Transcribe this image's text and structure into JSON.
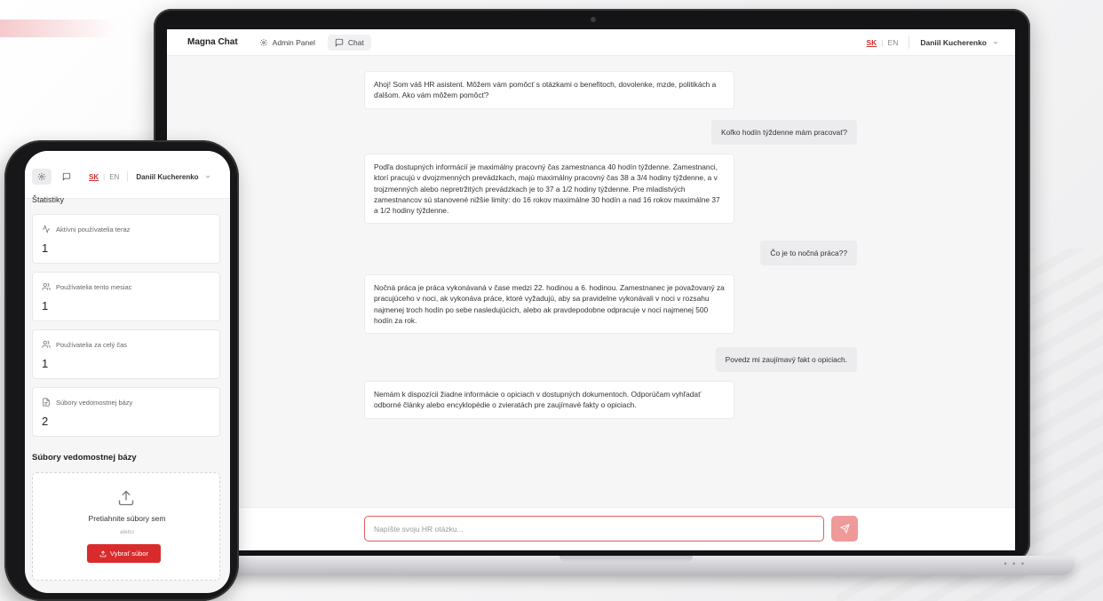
{
  "colors": {
    "accent": "#d92b2b",
    "input_border": "#e25c5c",
    "send_button": "#ef9a9a",
    "chat_bg": "#f6f6f7"
  },
  "laptop": {
    "header": {
      "brand": "Magna Chat",
      "nav": [
        {
          "label": "Admin Panel",
          "icon": "gear-icon"
        },
        {
          "label": "Chat",
          "icon": "message-square-icon",
          "active": true
        }
      ],
      "lang": {
        "sk": "SK",
        "en": "EN",
        "active": "SK"
      },
      "user": "Daniil Kucherenko"
    },
    "messages": [
      {
        "role": "bot",
        "text": "Ahoj! Som váš HR asistent. Môžem vám pomôcť s otázkami o benefitoch, dovolenke, mzde, politikách a ďalšom. Ako vám môžem pomôcť?"
      },
      {
        "role": "user",
        "text": "Koľko hodín týždenne mám pracovať?"
      },
      {
        "role": "bot",
        "text": "Podľa dostupných informácií je maximálny pracovný čas zamestnanca 40 hodín týždenne. Zamestnanci, ktorí pracujú v dvojzmenných prevádzkach, majú maximálny pracovný čas 38 a 3/4 hodiny týždenne, a v trojzmenných alebo nepretržitých prevádzkach je to 37 a 1/2 hodiny týždenne. Pre mladistvých zamestnancov sú stanovené nižšie limity: do 16 rokov maximálne 30 hodín a nad 16 rokov maximálne 37 a 1/2 hodiny týždenne."
      },
      {
        "role": "user",
        "text": "Čo je to nočná práca??"
      },
      {
        "role": "bot",
        "text": "Nočná práca je práca vykonávaná v čase medzi 22. hodinou a 6. hodinou. Zamestnanec je považovaný za pracujúceho v noci, ak vykonáva práce, ktoré vyžadujú, aby sa pravidelne vykonávali v noci v rozsahu najmenej troch hodín po sebe nasledujúcich, alebo ak pravdepodobne odpracuje v noci najmenej 500 hodín za rok."
      },
      {
        "role": "user",
        "text": "Povedz mi zaujímavý fakt o opiciach."
      },
      {
        "role": "bot",
        "text": "Nemám k dispozícii žiadne informácie o opiciach v dostupných dokumentoch. Odporúčam vyhľadať odborné články alebo encyklopédie o zvieratách pre zaujímavé fakty o opiciach."
      }
    ],
    "input": {
      "placeholder": "Napíšte svoju HR otázku...",
      "value": ""
    }
  },
  "phone": {
    "header": {
      "lang": {
        "sk": "SK",
        "en": "EN"
      },
      "user": "Daniil Kucherenko"
    },
    "stats_title": "Štatistiky",
    "stats": [
      {
        "label": "Aktívni používatelia teraz",
        "value": "1",
        "icon": "activity-icon"
      },
      {
        "label": "Používatelia tento mesiac",
        "value": "1",
        "icon": "users-icon"
      },
      {
        "label": "Používatelia za celý čas",
        "value": "1",
        "icon": "users-icon"
      },
      {
        "label": "Súbory vedomostnej bázy",
        "value": "2",
        "icon": "file-icon"
      }
    ],
    "kb_section": "Súbory vedomostnej bázy",
    "upload": {
      "prompt": "Pretiahnite súbory sem",
      "or": "alebo",
      "button": "Vybrať súbor"
    }
  }
}
